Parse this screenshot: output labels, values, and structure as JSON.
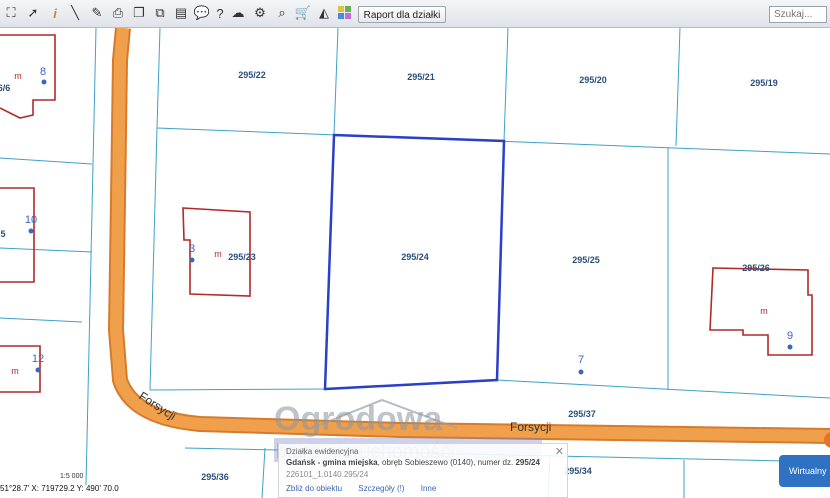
{
  "toolbar": {
    "icons": [
      "select-area-icon",
      "pointer-icon",
      "info-icon",
      "measure-line-icon",
      "measure-area-icon",
      "print-icon",
      "copy-icon",
      "layers-icon",
      "comment-icon",
      "cloud-upload-icon",
      "settings-icon",
      "help-icon",
      "zoom-icon",
      "cart-icon",
      "shape-icon",
      "palette-icon"
    ],
    "report_label": "Raport dla działki",
    "search_placeholder": "Szukaj..."
  },
  "map": {
    "parcels": [
      "295/22",
      "295/21",
      "295/20",
      "295/19",
      "295/23",
      "295/24",
      "295/25",
      "295/26",
      "295/37",
      "295/36",
      "295/34"
    ],
    "partial_labels": [
      "6/6",
      "5"
    ],
    "building_marker": "m",
    "house_numbers": [
      "8",
      "10",
      "12",
      "3",
      "9",
      "7"
    ],
    "street_name": "Forsycji",
    "colors": {
      "road": "#f0a04b",
      "road_edge": "#d77a2a",
      "parcel_line": "#3fa1c7",
      "building": "#b12a2a",
      "selected": "#2b3fc7",
      "address_dot": "#3b66c4"
    }
  },
  "popup": {
    "title": "Działka ewidencyjna",
    "location_bold": "Gdańsk - gmina miejska",
    "location_mid": ", obręb Sobieszewo (0140), numer dz.",
    "parcel": "295/24",
    "id": "226101_1.0140.295/24",
    "actions": [
      "Zbliż do obiektu",
      "Szczegóły (!)",
      "Inne"
    ]
  },
  "watermark": {
    "line1": "Ogrodowa",
    "line2": "biuro nieruchomości"
  },
  "status": {
    "coords": "51°28.7'  X: 719729.2  Y: 490' 70.0"
  },
  "scale_hint": "1:5 000",
  "sidebar_button": "Wirtualny"
}
